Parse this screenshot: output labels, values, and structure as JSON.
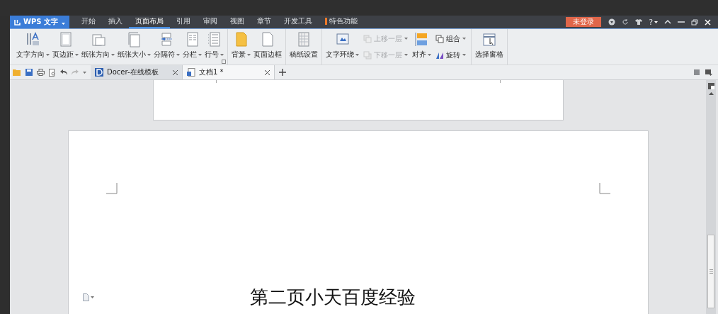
{
  "app_menu": {
    "label": "WPS 文字"
  },
  "menu_tabs": [
    {
      "label": "开始",
      "selected": false
    },
    {
      "label": "插入",
      "selected": false
    },
    {
      "label": "页面布局",
      "selected": true
    },
    {
      "label": "引用",
      "selected": false
    },
    {
      "label": "审阅",
      "selected": false
    },
    {
      "label": "视图",
      "selected": false
    },
    {
      "label": "章节",
      "selected": false
    },
    {
      "label": "开发工具",
      "selected": false
    },
    {
      "label": "特色功能",
      "selected": false,
      "kind": "marked"
    }
  ],
  "login_button": "未登录",
  "help_button": "?",
  "ribbon_groups": [
    {
      "launcher": true,
      "items": [
        {
          "kind": "large",
          "label": "文字方向",
          "has_menu": true
        },
        {
          "kind": "large",
          "label": "页边距",
          "has_menu": true
        },
        {
          "kind": "large",
          "label": "纸张方向",
          "has_menu": true
        },
        {
          "kind": "large",
          "label": "纸张大小",
          "has_menu": true
        },
        {
          "kind": "large",
          "label": "分隔符",
          "has_menu": true
        },
        {
          "kind": "large",
          "label": "分栏",
          "has_menu": true
        },
        {
          "kind": "large",
          "label": "行号",
          "has_menu": true
        }
      ]
    },
    {
      "launcher": false,
      "items": [
        {
          "kind": "large",
          "label": "背景",
          "has_menu": true
        },
        {
          "kind": "large",
          "label": "页面边框",
          "has_menu": false
        }
      ]
    },
    {
      "launcher": false,
      "items": [
        {
          "kind": "large",
          "label": "稿纸设置",
          "has_menu": false
        }
      ]
    },
    {
      "launcher": false,
      "items": [
        {
          "kind": "large",
          "label": "文字环绕",
          "has_menu": true
        },
        {
          "kind": "stack",
          "items": [
            {
              "label": "上移一层",
              "has_menu": true,
              "disabled": true
            },
            {
              "label": "下移一层",
              "has_menu": true,
              "disabled": true
            }
          ]
        },
        {
          "kind": "large",
          "label": "对齐",
          "has_menu": true
        },
        {
          "kind": "stack",
          "items": [
            {
              "label": "组合",
              "has_menu": true,
              "disabled": false
            },
            {
              "label": "旋转",
              "has_menu": true,
              "disabled": false
            }
          ]
        }
      ]
    },
    {
      "launcher": false,
      "items": [
        {
          "kind": "large",
          "label": "选择窗格",
          "has_menu": false
        }
      ]
    }
  ],
  "doc_tabs": [
    {
      "label": "Docer-在线模板",
      "selected": false
    },
    {
      "label": "文档1 *",
      "selected": true
    }
  ],
  "document": {
    "heading": "第二页小天百度经验"
  }
}
